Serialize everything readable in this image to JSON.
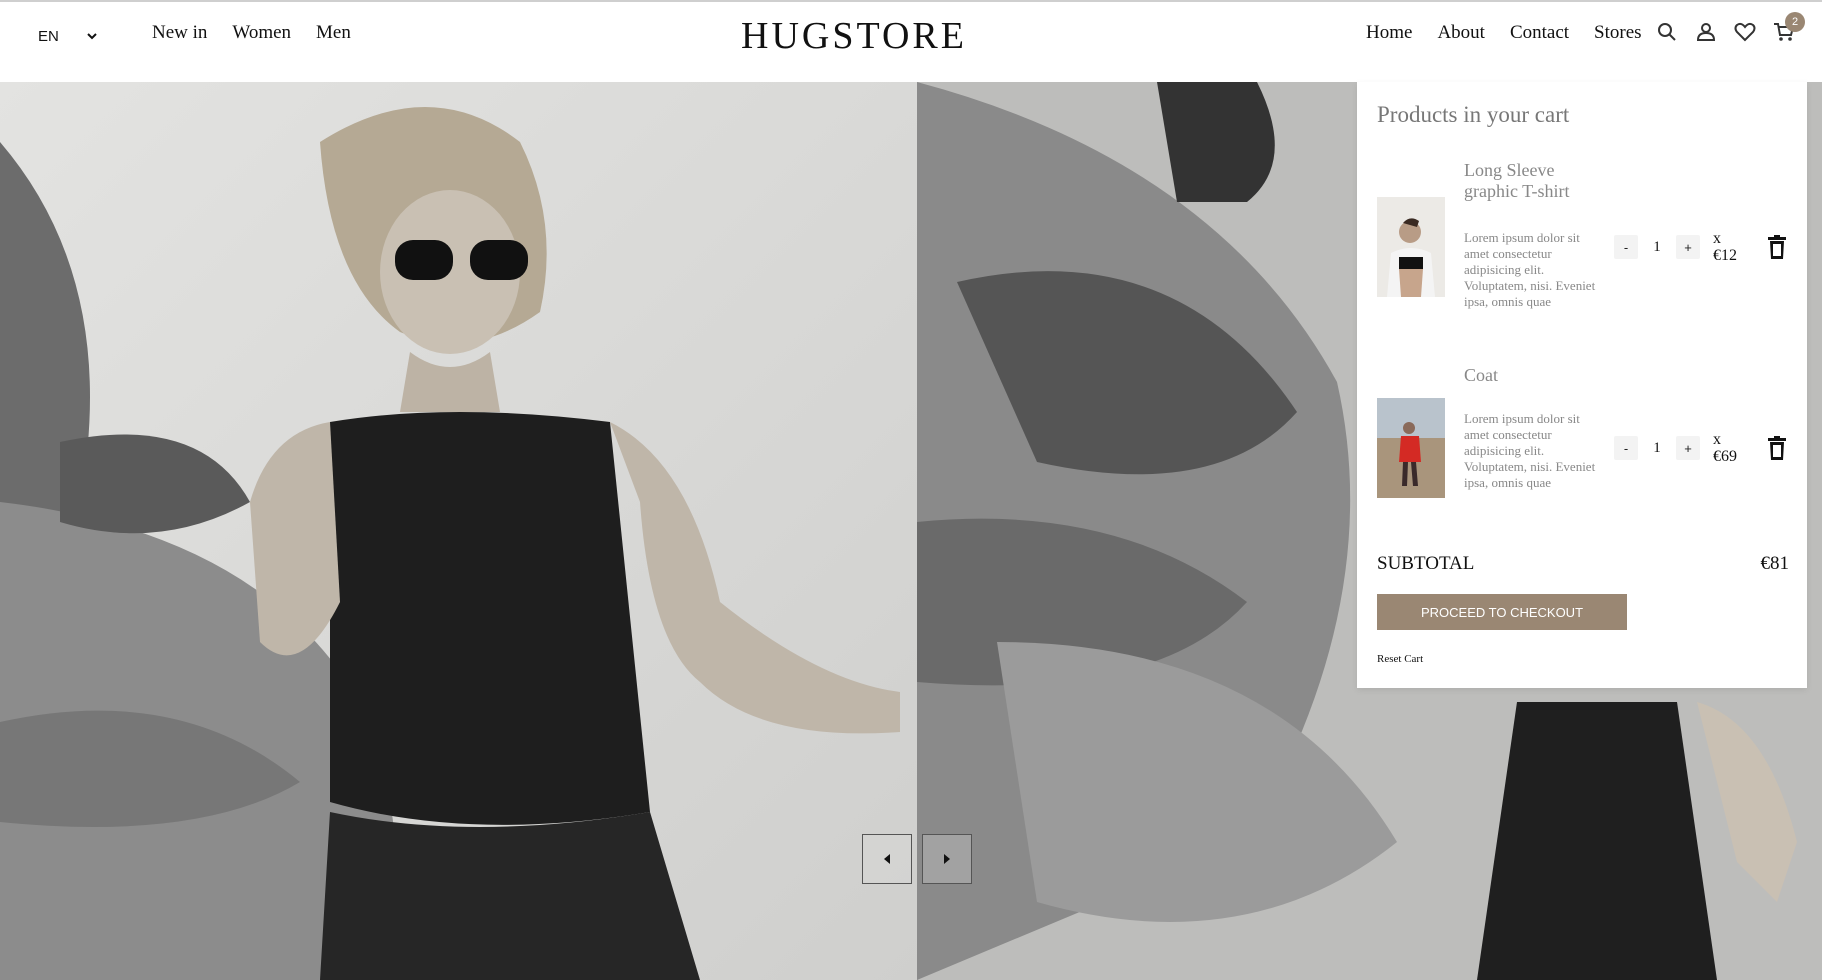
{
  "header": {
    "language": "EN",
    "left_nav": [
      "New in",
      "Women",
      "Men"
    ],
    "logo": "HUGSTORE",
    "right_nav": [
      "Home",
      "About",
      "Contact",
      "Stores"
    ],
    "cart_count": "2",
    "icons": [
      "search-icon",
      "user-icon",
      "heart-icon",
      "cart-icon"
    ]
  },
  "cart": {
    "title": "Products in your cart",
    "items": [
      {
        "name": "Long Sleeve graphic T-shirt",
        "description": "Lorem ipsum dolor sit amet consectetur adipisicing elit. Voluptatem, nisi. Eveniet ipsa, omnis quae",
        "quantity": "1",
        "minus": "-",
        "plus": "+",
        "x": "x",
        "price": "€12"
      },
      {
        "name": "Coat",
        "description": "Lorem ipsum dolor sit amet consectetur adipisicing elit. Voluptatem, nisi. Eveniet ipsa, omnis quae",
        "quantity": "1",
        "minus": "-",
        "plus": "+",
        "x": "x",
        "price": "€69"
      }
    ],
    "subtotal_label": "SUBTOTAL",
    "subtotal_value": "€81",
    "checkout_label": "PROCEED TO CHECKOUT",
    "reset_label": "Reset Cart"
  },
  "colors": {
    "accent": "#9a8773",
    "muted_text": "#888888"
  }
}
